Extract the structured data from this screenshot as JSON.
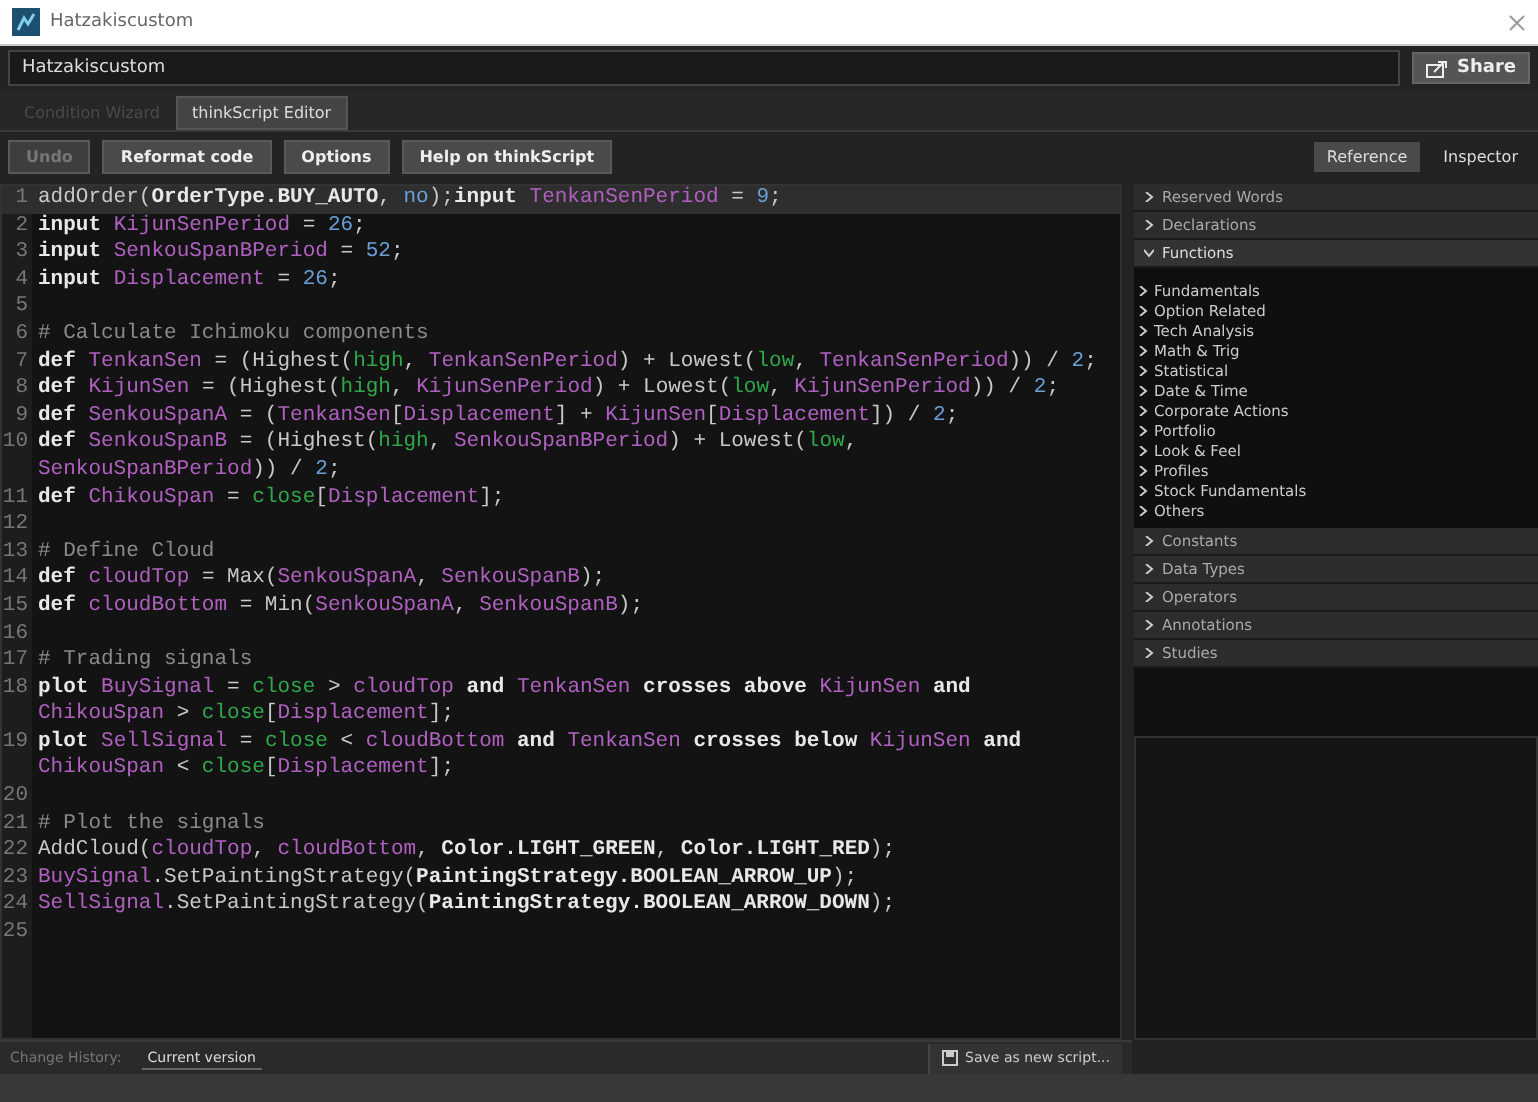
{
  "window": {
    "title": "Hatzakiscustom"
  },
  "name_field": {
    "value": "Hatzakiscustom"
  },
  "share_button": {
    "label": "Share"
  },
  "tabs": [
    {
      "label": "Condition Wizard",
      "selected": false,
      "disabled": true
    },
    {
      "label": "thinkScript Editor",
      "selected": true,
      "disabled": false
    }
  ],
  "toolbar": [
    {
      "label": "Undo",
      "disabled": true
    },
    {
      "label": "Reformat code",
      "disabled": false
    },
    {
      "label": "Options",
      "disabled": false
    },
    {
      "label": "Help on thinkScript",
      "disabled": false
    }
  ],
  "panel_tabs": [
    {
      "label": "Reference",
      "selected": true
    },
    {
      "label": "Inspector",
      "selected": false
    }
  ],
  "code_lines": [
    {
      "number": "1",
      "current": true,
      "tokens": [
        {
          "kind": "fn",
          "text": "addOrder("
        },
        {
          "kind": "kw",
          "text": "OrderType.BUY_AUTO"
        },
        {
          "kind": "op",
          "text": ", "
        },
        {
          "kind": "num",
          "text": "no"
        },
        {
          "kind": "op",
          "text": ");"
        },
        {
          "kind": "kw",
          "text": "input "
        },
        {
          "kind": "id",
          "text": "TenkanSenPeriod"
        },
        {
          "kind": "op",
          "text": " = "
        },
        {
          "kind": "num",
          "text": "9"
        },
        {
          "kind": "op",
          "text": ";"
        }
      ]
    },
    {
      "number": "2",
      "current": false,
      "tokens": [
        {
          "kind": "kw",
          "text": "input "
        },
        {
          "kind": "id",
          "text": "KijunSenPeriod"
        },
        {
          "kind": "op",
          "text": " = "
        },
        {
          "kind": "num",
          "text": "26"
        },
        {
          "kind": "op",
          "text": ";"
        }
      ]
    },
    {
      "number": "3",
      "current": false,
      "tokens": [
        {
          "kind": "kw",
          "text": "input "
        },
        {
          "kind": "id",
          "text": "SenkouSpanBPeriod"
        },
        {
          "kind": "op",
          "text": " = "
        },
        {
          "kind": "num",
          "text": "52"
        },
        {
          "kind": "op",
          "text": ";"
        }
      ]
    },
    {
      "number": "4",
      "current": false,
      "tokens": [
        {
          "kind": "kw",
          "text": "input "
        },
        {
          "kind": "id",
          "text": "Displacement"
        },
        {
          "kind": "op",
          "text": " = "
        },
        {
          "kind": "num",
          "text": "26"
        },
        {
          "kind": "op",
          "text": ";"
        }
      ]
    },
    {
      "number": "5",
      "current": false
    },
    {
      "number": "6",
      "current": false,
      "tokens": [
        {
          "kind": "cmt",
          "text": "# Calculate Ichimoku components"
        }
      ]
    },
    {
      "number": "7",
      "current": false,
      "tokens": [
        {
          "kind": "kw",
          "text": "def "
        },
        {
          "kind": "id",
          "text": "TenkanSen"
        },
        {
          "kind": "fn",
          "text": " = (Highest("
        },
        {
          "kind": "const",
          "text": "high"
        },
        {
          "kind": "fn",
          "text": ", "
        },
        {
          "kind": "id",
          "text": "TenkanSenPeriod"
        },
        {
          "kind": "fn",
          "text": ") + Lowest("
        },
        {
          "kind": "const",
          "text": "low"
        },
        {
          "kind": "fn",
          "text": ", "
        },
        {
          "kind": "id",
          "text": "TenkanSenPeriod"
        },
        {
          "kind": "fn",
          "text": ")) / "
        },
        {
          "kind": "num",
          "text": "2"
        },
        {
          "kind": "op",
          "text": ";"
        }
      ]
    },
    {
      "number": "8",
      "current": false,
      "tokens": [
        {
          "kind": "kw",
          "text": "def "
        },
        {
          "kind": "id",
          "text": "KijunSen"
        },
        {
          "kind": "fn",
          "text": " = (Highest("
        },
        {
          "kind": "const",
          "text": "high"
        },
        {
          "kind": "fn",
          "text": ", "
        },
        {
          "kind": "id",
          "text": "KijunSenPeriod"
        },
        {
          "kind": "fn",
          "text": ") + Lowest("
        },
        {
          "kind": "const",
          "text": "low"
        },
        {
          "kind": "fn",
          "text": ", "
        },
        {
          "kind": "id",
          "text": "KijunSenPeriod"
        },
        {
          "kind": "fn",
          "text": ")) / "
        },
        {
          "kind": "num",
          "text": "2"
        },
        {
          "kind": "op",
          "text": ";"
        }
      ]
    },
    {
      "number": "9",
      "current": false,
      "tokens": [
        {
          "kind": "kw",
          "text": "def "
        },
        {
          "kind": "id",
          "text": "SenkouSpanA"
        },
        {
          "kind": "fn",
          "text": " = ("
        },
        {
          "kind": "id",
          "text": "TenkanSen"
        },
        {
          "kind": "fn",
          "text": "["
        },
        {
          "kind": "id",
          "text": "Displacement"
        },
        {
          "kind": "fn",
          "text": "] + "
        },
        {
          "kind": "id",
          "text": "KijunSen"
        },
        {
          "kind": "fn",
          "text": "["
        },
        {
          "kind": "id",
          "text": "Displacement"
        },
        {
          "kind": "fn",
          "text": "]) / "
        },
        {
          "kind": "num",
          "text": "2"
        },
        {
          "kind": "op",
          "text": ";"
        }
      ]
    },
    {
      "number": "10",
      "current": false,
      "tokens": [
        {
          "kind": "kw",
          "text": "def "
        },
        {
          "kind": "id",
          "text": "SenkouSpanB"
        },
        {
          "kind": "fn",
          "text": " = (Highest("
        },
        {
          "kind": "const",
          "text": "high"
        },
        {
          "kind": "fn",
          "text": ", "
        },
        {
          "kind": "id",
          "text": "SenkouSpanBPeriod"
        },
        {
          "kind": "fn",
          "text": ") + Lowest("
        },
        {
          "kind": "const",
          "text": "low"
        },
        {
          "kind": "fn",
          "text": ", "
        },
        {
          "kind": "id",
          "text": "SenkouSpanBPeriod"
        },
        {
          "kind": "fn",
          "text": ")) / "
        },
        {
          "kind": "num",
          "text": "2"
        },
        {
          "kind": "op",
          "text": ";"
        }
      ]
    },
    {
      "number": "11",
      "current": false,
      "tokens": [
        {
          "kind": "kw",
          "text": "def "
        },
        {
          "kind": "id",
          "text": "ChikouSpan"
        },
        {
          "kind": "fn",
          "text": " = "
        },
        {
          "kind": "const",
          "text": "close"
        },
        {
          "kind": "fn",
          "text": "["
        },
        {
          "kind": "id",
          "text": "Displacement"
        },
        {
          "kind": "fn",
          "text": "]"
        },
        {
          "kind": "op",
          "text": ";"
        }
      ]
    },
    {
      "number": "12",
      "current": false
    },
    {
      "number": "13",
      "current": false,
      "tokens": [
        {
          "kind": "cmt",
          "text": "# Define Cloud"
        }
      ]
    },
    {
      "number": "14",
      "current": false,
      "tokens": [
        {
          "kind": "kw",
          "text": "def "
        },
        {
          "kind": "id",
          "text": "cloudTop"
        },
        {
          "kind": "fn",
          "text": " = Max("
        },
        {
          "kind": "id",
          "text": "SenkouSpanA"
        },
        {
          "kind": "fn",
          "text": ", "
        },
        {
          "kind": "id",
          "text": "SenkouSpanB"
        },
        {
          "kind": "fn",
          "text": ")"
        },
        {
          "kind": "op",
          "text": ";"
        }
      ]
    },
    {
      "number": "15",
      "current": false,
      "tokens": [
        {
          "kind": "kw",
          "text": "def "
        },
        {
          "kind": "id",
          "text": "cloudBottom"
        },
        {
          "kind": "fn",
          "text": " = Min("
        },
        {
          "kind": "id",
          "text": "SenkouSpanA"
        },
        {
          "kind": "fn",
          "text": ", "
        },
        {
          "kind": "id",
          "text": "SenkouSpanB"
        },
        {
          "kind": "fn",
          "text": ")"
        },
        {
          "kind": "op",
          "text": ";"
        }
      ]
    },
    {
      "number": "16",
      "current": false
    },
    {
      "number": "17",
      "current": false,
      "tokens": [
        {
          "kind": "cmt",
          "text": "# Trading signals"
        }
      ]
    },
    {
      "number": "18",
      "current": false,
      "tokens": [
        {
          "kind": "kw",
          "text": "plot "
        },
        {
          "kind": "id",
          "text": "BuySignal"
        },
        {
          "kind": "fn",
          "text": " = "
        },
        {
          "kind": "const",
          "text": "close"
        },
        {
          "kind": "fn",
          "text": " > "
        },
        {
          "kind": "id",
          "text": "cloudTop"
        },
        {
          "kind": "kw",
          "text": " and "
        },
        {
          "kind": "id",
          "text": "TenkanSen"
        },
        {
          "kind": "kw",
          "text": " crosses above "
        },
        {
          "kind": "id",
          "text": "KijunSen"
        },
        {
          "kind": "kw",
          "text": " and "
        },
        {
          "kind": "id",
          "text": "ChikouSpan"
        },
        {
          "kind": "fn",
          "text": " > "
        },
        {
          "kind": "const",
          "text": "close"
        },
        {
          "kind": "fn",
          "text": "["
        },
        {
          "kind": "id",
          "text": "Displacement"
        },
        {
          "kind": "fn",
          "text": "]"
        },
        {
          "kind": "op",
          "text": ";"
        }
      ]
    },
    {
      "number": "19",
      "current": false,
      "tokens": [
        {
          "kind": "kw",
          "text": "plot "
        },
        {
          "kind": "id",
          "text": "SellSignal"
        },
        {
          "kind": "fn",
          "text": " = "
        },
        {
          "kind": "const",
          "text": "close"
        },
        {
          "kind": "fn",
          "text": " < "
        },
        {
          "kind": "id",
          "text": "cloudBottom"
        },
        {
          "kind": "kw",
          "text": " and "
        },
        {
          "kind": "id",
          "text": "TenkanSen"
        },
        {
          "kind": "kw",
          "text": " crosses below "
        },
        {
          "kind": "id",
          "text": "KijunSen"
        },
        {
          "kind": "kw",
          "text": " and "
        },
        {
          "kind": "id",
          "text": "ChikouSpan"
        },
        {
          "kind": "fn",
          "text": " < "
        },
        {
          "kind": "const",
          "text": "close"
        },
        {
          "kind": "fn",
          "text": "["
        },
        {
          "kind": "id",
          "text": "Displacement"
        },
        {
          "kind": "fn",
          "text": "]"
        },
        {
          "kind": "op",
          "text": ";"
        }
      ]
    },
    {
      "number": "20",
      "current": false
    },
    {
      "number": "21",
      "current": false,
      "tokens": [
        {
          "kind": "cmt",
          "text": "# Plot the signals"
        }
      ]
    },
    {
      "number": "22",
      "current": false,
      "tokens": [
        {
          "kind": "fn",
          "text": "AddCloud("
        },
        {
          "kind": "id",
          "text": "cloudTop"
        },
        {
          "kind": "fn",
          "text": ", "
        },
        {
          "kind": "id",
          "text": "cloudBottom"
        },
        {
          "kind": "fn",
          "text": ", "
        },
        {
          "kind": "kw",
          "text": "Color.LIGHT_GREEN"
        },
        {
          "kind": "fn",
          "text": ", "
        },
        {
          "kind": "kw",
          "text": "Color.LIGHT_RED"
        },
        {
          "kind": "fn",
          "text": ")"
        },
        {
          "kind": "op",
          "text": ";"
        }
      ]
    },
    {
      "number": "23",
      "current": false,
      "tokens": [
        {
          "kind": "id",
          "text": "BuySignal"
        },
        {
          "kind": "fn",
          "text": ".SetPaintingStrategy("
        },
        {
          "kind": "kw",
          "text": "PaintingStrategy.BOOLEAN_ARROW_UP"
        },
        {
          "kind": "fn",
          "text": ")"
        },
        {
          "kind": "op",
          "text": ";"
        }
      ]
    },
    {
      "number": "24",
      "current": false,
      "tokens": [
        {
          "kind": "id",
          "text": "SellSignal"
        },
        {
          "kind": "fn",
          "text": ".SetPaintingStrategy("
        },
        {
          "kind": "kw",
          "text": "PaintingStrategy.BOOLEAN_ARROW_DOWN"
        },
        {
          "kind": "fn",
          "text": ")"
        },
        {
          "kind": "op",
          "text": ";"
        }
      ]
    },
    {
      "number": "25",
      "current": false
    }
  ],
  "reference": [
    {
      "label": "Reserved Words",
      "expanded": false
    },
    {
      "label": "Declarations",
      "expanded": false
    },
    {
      "label": "Functions",
      "expanded": true,
      "children": [
        "Fundamentals",
        "Option Related",
        "Tech Analysis",
        "Math & Trig",
        "Statistical",
        "Date & Time",
        "Corporate Actions",
        "Portfolio",
        "Look & Feel",
        "Profiles",
        "Stock Fundamentals",
        "Others"
      ]
    },
    {
      "label": "Constants",
      "expanded": false
    },
    {
      "label": "Data Types",
      "expanded": false
    },
    {
      "label": "Operators",
      "expanded": false
    },
    {
      "label": "Annotations",
      "expanded": false
    },
    {
      "label": "Studies",
      "expanded": false
    }
  ],
  "status_bar": {
    "label": "Change History:",
    "version": "Current version",
    "save_button": "Save as new script..."
  }
}
